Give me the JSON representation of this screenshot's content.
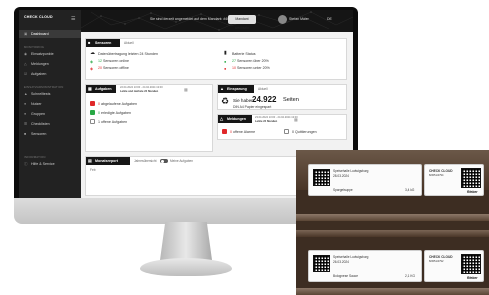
{
  "sidebar": {
    "logo": "CHECK CLOUD",
    "items": [
      {
        "label": "Dashboard",
        "icon": "dashboard-icon",
        "active": true
      },
      {
        "label": "Einsatzpunkte",
        "icon": "pin-icon"
      },
      {
        "label": "Meldungen",
        "icon": "bell-icon"
      },
      {
        "label": "Aufgaben",
        "icon": "tasks-icon"
      },
      {
        "label": "Schnelltests",
        "icon": "flask-icon"
      },
      {
        "label": "Nutzer",
        "icon": "user-icon"
      },
      {
        "label": "Gruppen",
        "icon": "group-icon"
      },
      {
        "label": "Checklisten",
        "icon": "checklist-icon"
      },
      {
        "label": "Sensoren",
        "icon": "sensor-icon"
      },
      {
        "label": "Hilfe & Service",
        "icon": "help-icon"
      }
    ],
    "sections": [
      "MONITORING",
      "EINSATZADMINISTRATION",
      "INFORMATION"
    ]
  },
  "header": {
    "login_text": "Sie sind derzeit angemeldet auf dem Mandant: #4000071",
    "logout_button": "Mandant wechseln",
    "user_name": "Stefan Maier",
    "language": "DE"
  },
  "sensors_card": {
    "title": "Sensoren",
    "subtitle": "Aktuell",
    "transfer_title": "Datenübertragung letzten 24 Stunden",
    "online_count": "12",
    "online_label": "Sensoren online",
    "offline_count": "20",
    "offline_label": "Sensoren offline",
    "battery_title": "Batterie Status",
    "battery_good_count": "27",
    "battery_good_label": "Sensoren über 20%",
    "battery_low_count": "10",
    "battery_low_label": "Sensoren unter 20%"
  },
  "tasks_card": {
    "title": "Aufgaben",
    "range_text": "22.04.2024 13:00 - 24.04.2024 13:00",
    "range_label": "Letzte und nächste 24 Stunden",
    "expired_count": "0",
    "expired_label": "abgelaufene Aufgaben",
    "done_count": "0",
    "done_label": "erledigte Aufgaben",
    "open_count": "1",
    "open_label": "offene Aufgaben"
  },
  "savings_card": {
    "title": "Einsparung",
    "subtitle": "Aktuell",
    "intro": "Sie haben",
    "pages": "24.922",
    "pages_unit": "Seiten",
    "note": "DIN A4 Papier eingespart"
  },
  "alerts_card": {
    "title": "Meldungen",
    "range_text": "23.04.2024 13:00 - 24.04.2024 13:00",
    "range_label": "Letzte 24 Stunden",
    "open_count": "0",
    "open_label": "offene Alarme",
    "ack_count": "0",
    "ack_label": "Quittierungen"
  },
  "report_card": {
    "title": "Monatsreport",
    "subtitle": "Jahresübersicht",
    "toggle_label": "Meine Aufgaben",
    "year": "Feb"
  },
  "labels": [
    {
      "brand": "CHECK CLOUD",
      "sub": "8/3051/4794",
      "company": "Speisehalle Ludwigsburg",
      "date": "28.03.2024",
      "item": "Spargelsuppe",
      "weight": "3,4 kG",
      "logo": "Rieber"
    },
    {
      "brand": "CHECK CLOUD",
      "sub": "8/3051/4792",
      "company": "Speisehalle Ludwigsburg",
      "date": "26.03.2024",
      "item": "Bolognese Sauce",
      "weight": "2,1 KG",
      "logo": "Rieber"
    }
  ],
  "colors": {
    "accent": "#161616",
    "ok": "#27a844",
    "alert": "#e0282a"
  }
}
